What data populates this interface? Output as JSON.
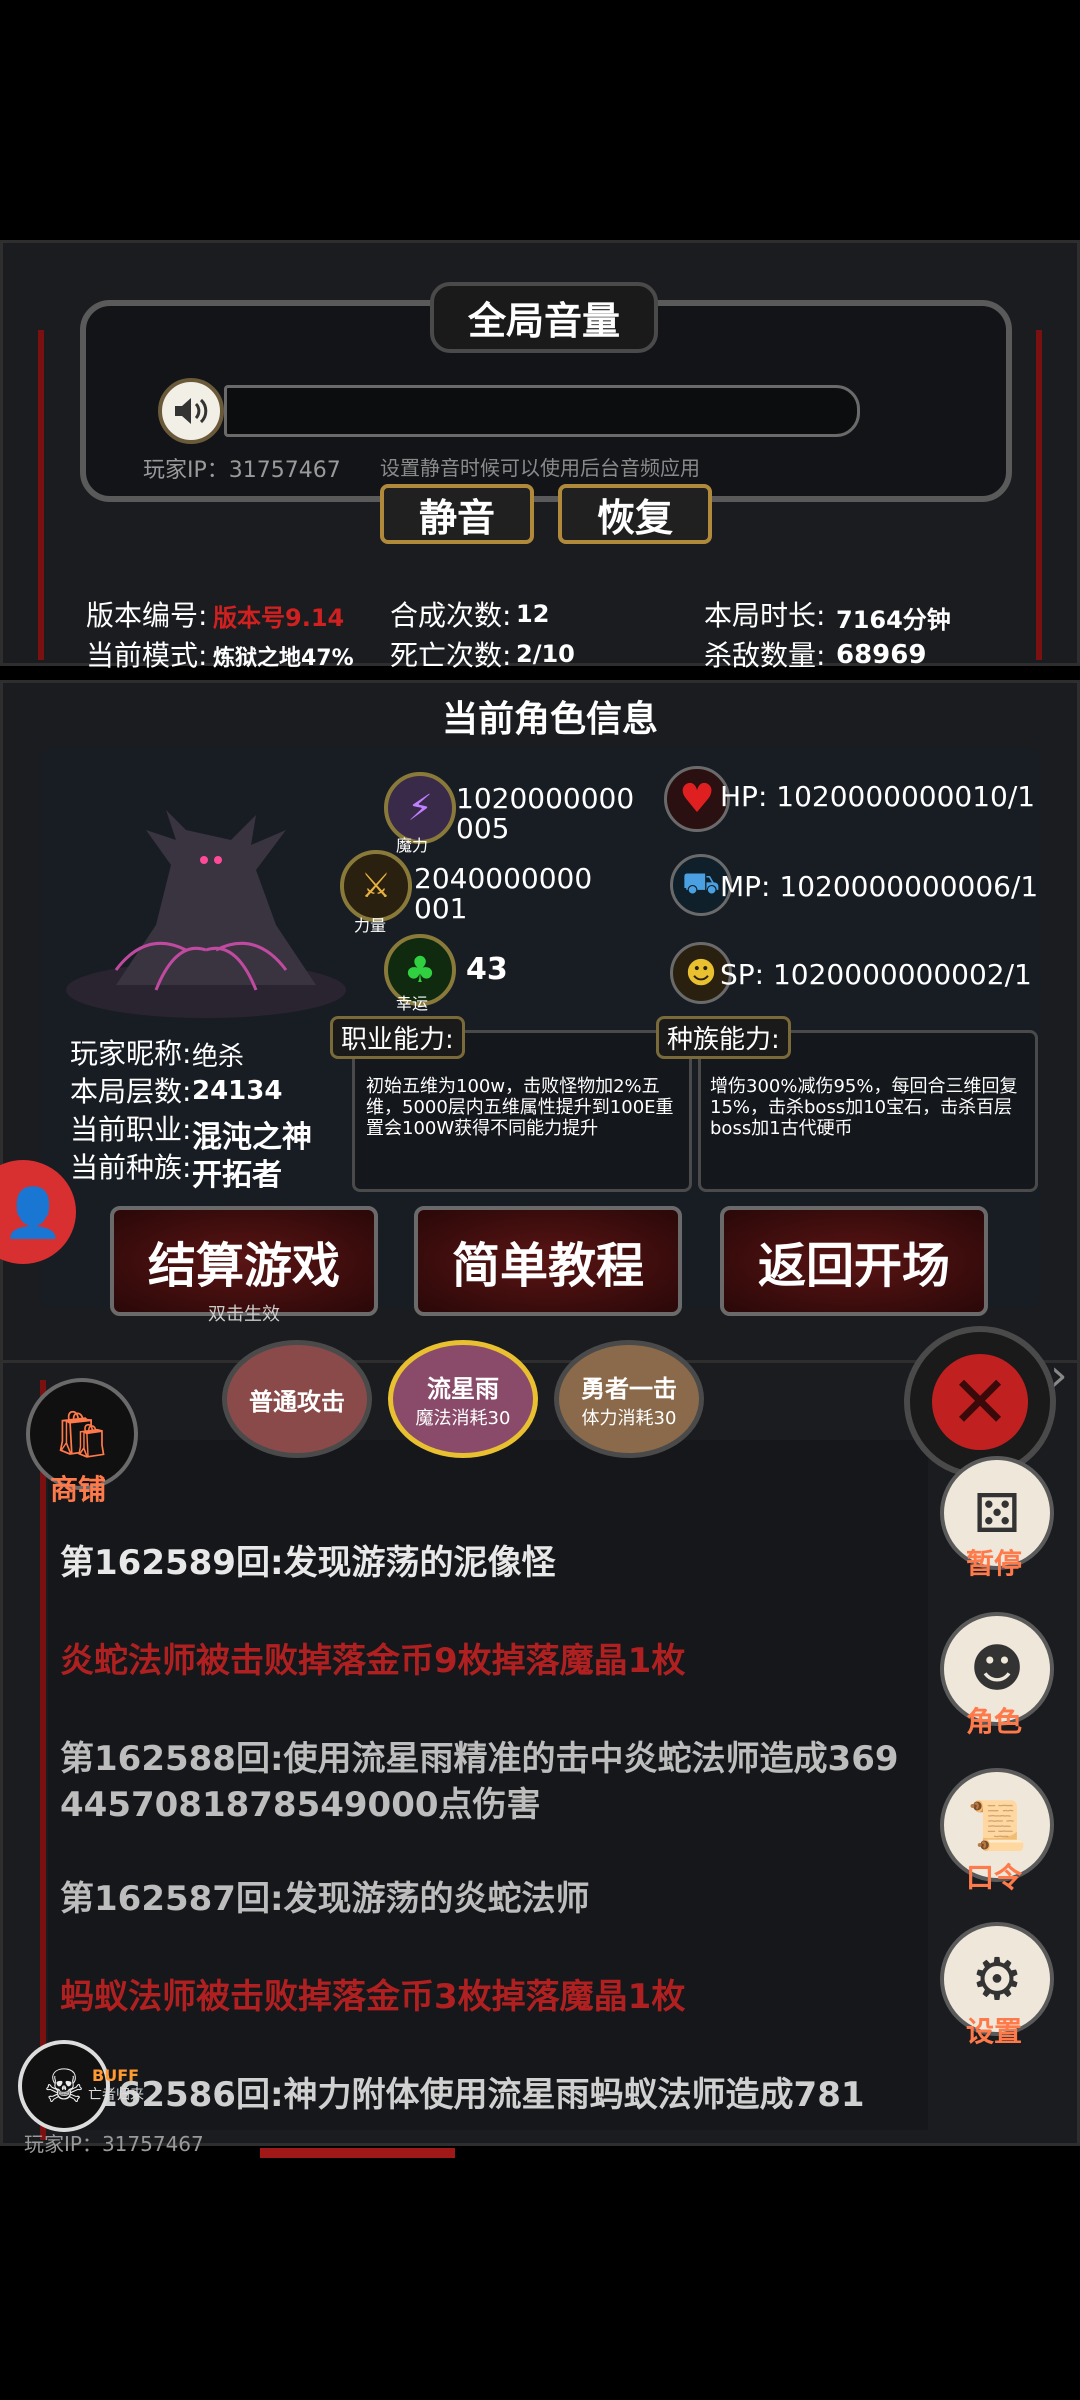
{
  "volume_panel": {
    "title": "全局音量",
    "player_ip": "玩家IP：31757467",
    "hint": "设置静音时候可以使用后台音频应用",
    "mute_label": "静音",
    "restore_label": "恢复"
  },
  "stats": {
    "version_label": "版本编号:",
    "version_value": "版本号9.14",
    "mode_label": "当前模式:",
    "mode_value": "炼狱之地47%",
    "merge_label": "合成次数:",
    "merge_value": "12",
    "death_label": "死亡次数:",
    "death_value": "2/10",
    "duration_label": "本局时长:",
    "duration_value": "7164分钟",
    "kills_label": "杀敌数量:",
    "kills_value": "68969"
  },
  "character": {
    "section_title": "当前角色信息",
    "magic_value": "1020000000005",
    "magic_caption": "魔力",
    "strength_value": "2040000000001",
    "strength_caption": "力量",
    "luck_value": "43",
    "luck_caption": "幸运",
    "hp": "HP:  1020000000010/1",
    "mp": "MP:  1020000000006/1",
    "sp": "SP:  1020000000002/1",
    "nickname_label": "玩家昵称:",
    "nickname_value": "绝杀",
    "floor_label": "本局层数:",
    "floor_value": "24134",
    "job_label": "当前职业:",
    "job_value": "混沌之神",
    "race_label": "当前种族:",
    "race_value": "开拓者",
    "job_ability_title": "职业能力:",
    "job_ability_text": "初始五维为100w，击败怪物加2%五维，5000层内五维属性提升到100E重置会100W获得不同能力提升",
    "race_ability_title": "种族能力:",
    "race_ability_text": "增伤300%减伤95%，每回合三维回复15%，击杀boss加10宝石，击杀百层boss加1古代硬币"
  },
  "actions": {
    "settle": "结算游戏",
    "settle_hint": "双击生效",
    "tutorial": "简单教程",
    "back": "返回开场"
  },
  "skills": {
    "normal": "普通攻击",
    "meteor": "流星雨",
    "meteor_cost": "魔法消耗30",
    "brave": "勇者一击",
    "brave_cost": "体力消耗30"
  },
  "sidebar": {
    "shop": "商铺",
    "pause": "暂停",
    "role": "角色",
    "code": "口令",
    "settings": "设置"
  },
  "log": [
    {
      "text": "第162589回:发现游荡的泥像怪",
      "color": "#e8e8e8"
    },
    {
      "text": "炎蛇法师被击败掉落金币9枚掉落魔晶1枚",
      "color": "#b02020"
    },
    {
      "text": "第162588回:使用流星雨精准的击中炎蛇法师造成3694457081878549000点伤害",
      "color": "#bdbdbd"
    },
    {
      "text": "第162587回:发现游荡的炎蛇法师",
      "color": "#bdbdbd"
    },
    {
      "text": "蚂蚁法师被击败掉落金币3枚掉落魔晶1枚",
      "color": "#b02020"
    },
    {
      "text": "162586回:神力附体使用流星雨蚂蚁法师造成781",
      "color": "#d0d0d0"
    }
  ],
  "footer": {
    "buff": "BUFF",
    "buff_sub": "亡者归来",
    "ip": "玩家IP：31757467"
  },
  "colors": {
    "accent_red": "#b02020",
    "orange": "#ff7a4a"
  }
}
